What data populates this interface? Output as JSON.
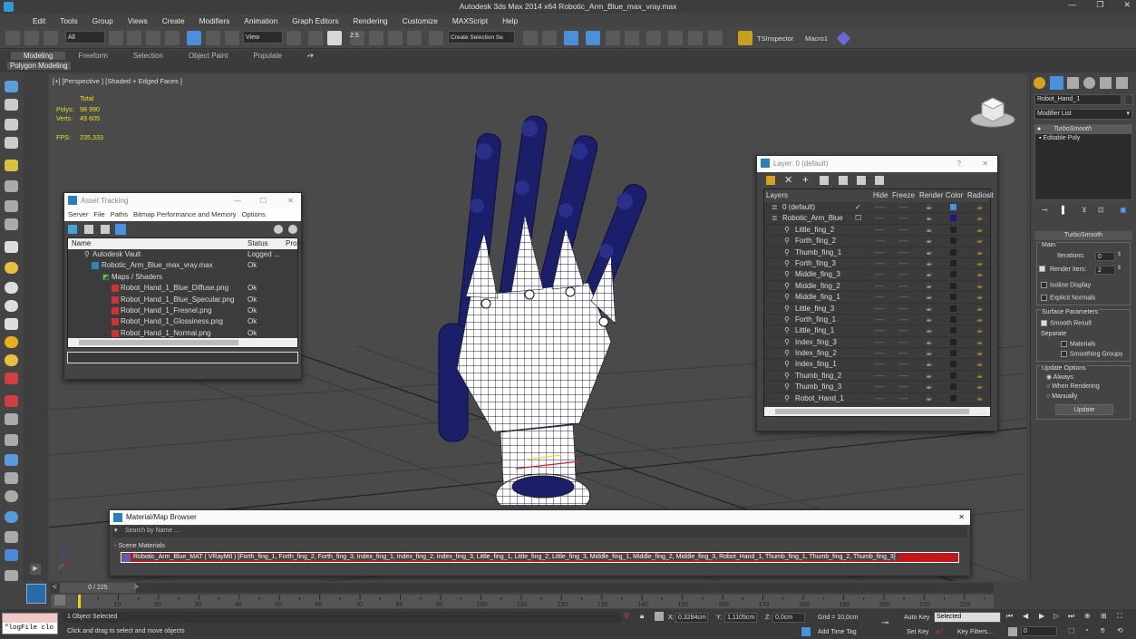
{
  "app": {
    "title": "Autodesk 3ds Max  2014 x64     Robotic_Arm_Blue_max_vray.max"
  },
  "menu": [
    "Edit",
    "Tools",
    "Group",
    "Views",
    "Create",
    "Modifiers",
    "Animation",
    "Graph Editors",
    "Rendering",
    "Customize",
    "MAXScript",
    "Help"
  ],
  "toolbar": {
    "filter_select": "All",
    "view_select": "View",
    "selection_set": "Create Selection Se",
    "tsinspector": "TSInspector",
    "macro": "Macro1",
    "snap_label": "2.5"
  },
  "ribbon": {
    "tabs": [
      "Modeling",
      "Freeform",
      "Selection",
      "Object Paint",
      "Populate"
    ],
    "sub": "Polygon Modeling"
  },
  "viewport": {
    "label": "[+] [Perspective ] [Shaded + Edged Faces ]",
    "stats": {
      "total": "Total",
      "polys_label": "Polys:",
      "polys": "98 990",
      "verts_label": "Verts:",
      "verts": "49 605",
      "fps_label": "FPS:",
      "fps": "235,333"
    }
  },
  "asset_tracking": {
    "title": "Asset Tracking",
    "menu": [
      "Server",
      "File",
      "Paths",
      "Bitmap Performance and Memory",
      "Options"
    ],
    "columns": [
      "Name",
      "Status",
      "Proxy"
    ],
    "rows": [
      {
        "name": "Autodesk Vault",
        "status": "Logged ..."
      },
      {
        "name": "Robotic_Arm_Blue_max_vray.max",
        "status": "Ok"
      },
      {
        "name": "Maps / Shaders",
        "status": ""
      },
      {
        "name": "Robot_Hand_1_Blue_Diffuse.png",
        "status": "Ok"
      },
      {
        "name": "Robot_Hand_1_Blue_Specular.png",
        "status": "Ok"
      },
      {
        "name": "Robot_Hand_1_Fresnel.png",
        "status": "Ok"
      },
      {
        "name": "Robot_Hand_1_Glossiness.png",
        "status": "Ok"
      },
      {
        "name": "Robot_Hand_1_Normal.png",
        "status": "Ok"
      }
    ]
  },
  "layer_window": {
    "title": "Layer: 0 (default)",
    "help": "?",
    "columns": [
      "Layers",
      "Hide",
      "Freeze",
      "Render",
      "Color",
      "Radiosit"
    ],
    "rows": [
      {
        "name": "0 (default)"
      },
      {
        "name": "Robotic_Arm_Blue"
      },
      {
        "name": "Little_fing_2"
      },
      {
        "name": "Forth_fing_2"
      },
      {
        "name": "Thumb_fing_1"
      },
      {
        "name": "Forth_fing_3"
      },
      {
        "name": "Middle_fing_3"
      },
      {
        "name": "Middle_fing_2"
      },
      {
        "name": "Middle_fing_1"
      },
      {
        "name": "Little_fing_3"
      },
      {
        "name": "Forth_fing_1"
      },
      {
        "name": "Little_fing_1"
      },
      {
        "name": "Index_fing_3"
      },
      {
        "name": "Index_fing_2"
      },
      {
        "name": "Index_fing_1"
      },
      {
        "name": "Thumb_fing_2"
      },
      {
        "name": "Thumb_fing_3"
      },
      {
        "name": "Robot_Hand_1"
      }
    ]
  },
  "material_browser": {
    "title": "Material/Map Browser",
    "search_placeholder": "Search by Name ...",
    "section": "- Scene Materials",
    "material": "Robotic_Arm_Blue_MAT  ( VRayMtl ) [Forth_fing_1, Forth_fing_2, Forth_fing_3, Index_fing_1, Index_fing_2, Index_fing_3, Little_fing_1, Little_fing_2, Little_fing_3, Middle_fing_1, Middle_fing_2, Middle_fing_3, Robot_Hand_1, Thumb_fing_1, Thumb_fing_2, Thumb_fing_3]"
  },
  "command_panel": {
    "object_name": "Robot_Hand_1",
    "modifier_list": "Modifier List",
    "stack": [
      "TurboSmooth",
      "Editable Poly"
    ],
    "rollout_title": "TurboSmooth",
    "main": "Main",
    "iterations_label": "Iterations:",
    "iterations": "0",
    "render_iters_label": "Render Iters:",
    "render_iters": "2",
    "isoline": "Isoline Display",
    "explicit_normals": "Explicit Normals",
    "surface_params": "Surface Parameters",
    "smooth_result": "Smooth Result",
    "separate": "Separate",
    "materials": "Materials",
    "smoothing_groups": "Smoothing Groups",
    "update_options": "Update Options",
    "always": "Always",
    "when_rendering": "When Rendering",
    "manually": "Manually",
    "update": "Update"
  },
  "timeline": {
    "frame": "0 / 225",
    "ticks": [
      "10",
      "20",
      "30",
      "40",
      "50",
      "60",
      "70",
      "80",
      "90",
      "100",
      "110",
      "120",
      "130",
      "140",
      "150",
      "160",
      "170",
      "180",
      "190",
      "200",
      "210",
      "220"
    ]
  },
  "status": {
    "listener": "\"logFile clo",
    "selected": "1 Object Selected",
    "prompt": "Click and drag to select and move objects",
    "x_label": "X:",
    "x": "0,3284cm",
    "y_label": "Y:",
    "y": "1,1105cm",
    "z_label": "Z:",
    "z": "0,0cm",
    "grid": "Grid = 10,0cm",
    "add_time_tag": "Add Time Tag",
    "auto_key": "Auto Key",
    "set_key": "Set Key",
    "selected_dropdown": "Selected",
    "key_filters": "Key Filters...",
    "frame_field": "0"
  }
}
